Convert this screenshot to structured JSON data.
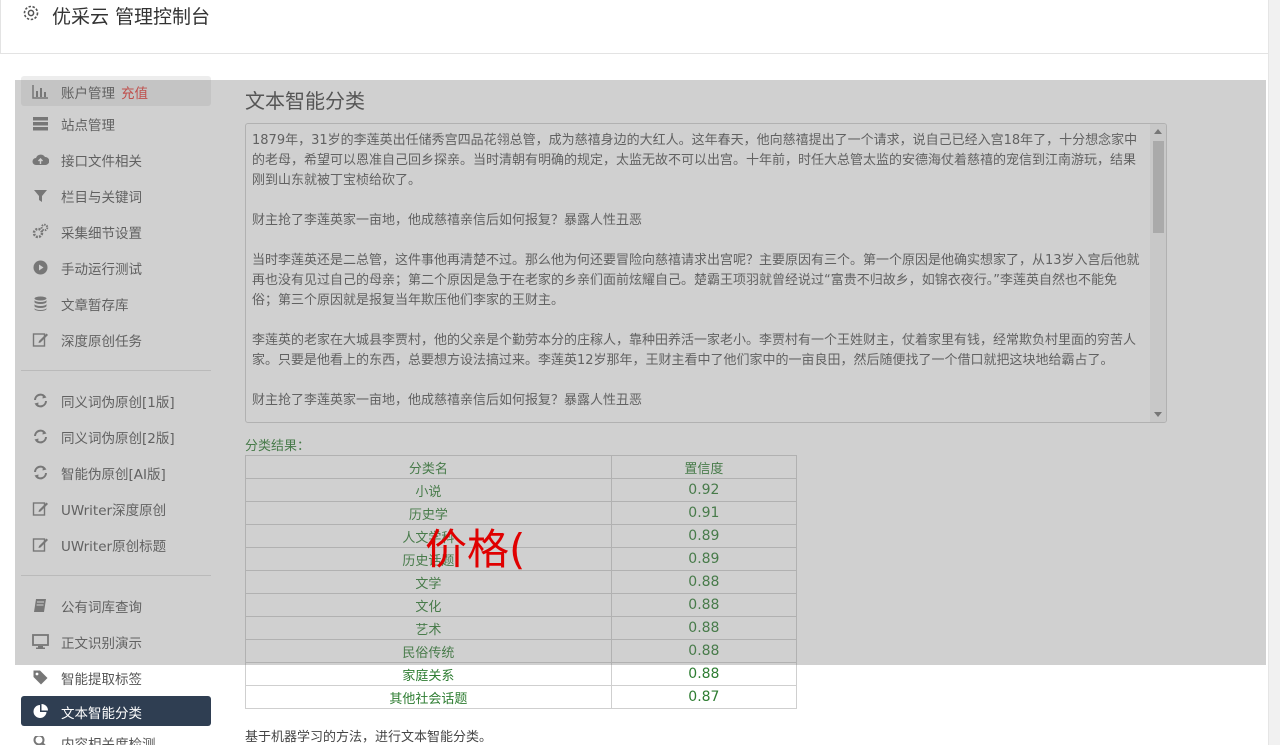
{
  "header": {
    "title": "优采云 管理控制台",
    "icon": "gear-icon"
  },
  "sidebar": {
    "group1": [
      {
        "label": "账户管理",
        "extra": "充值",
        "icon": "bar-chart-icon"
      },
      {
        "label": "站点管理",
        "icon": "server-icon"
      },
      {
        "label": "接口文件相关",
        "icon": "cloud-upload-icon"
      },
      {
        "label": "栏目与关键词",
        "icon": "filter-icon"
      },
      {
        "label": "采集细节设置",
        "icon": "cogs-icon"
      },
      {
        "label": "手动运行测试",
        "icon": "play-circle-icon"
      },
      {
        "label": "文章暂存库",
        "icon": "database-icon"
      },
      {
        "label": "深度原创任务",
        "icon": "edit-icon"
      }
    ],
    "group2": [
      {
        "label": "同义词伪原创[1版]",
        "icon": "refresh-icon"
      },
      {
        "label": "同义词伪原创[2版]",
        "icon": "refresh-icon"
      },
      {
        "label": "智能伪原创[AI版]",
        "icon": "refresh-icon"
      },
      {
        "label": "UWriter深度原创",
        "icon": "edit-icon"
      },
      {
        "label": "UWriter原创标题",
        "icon": "edit-icon"
      }
    ],
    "group3": [
      {
        "label": "公有词库查询",
        "icon": "book-icon"
      },
      {
        "label": "正文识别演示",
        "icon": "monitor-icon"
      },
      {
        "label": "智能提取标签",
        "icon": "tag-icon"
      },
      {
        "label": "文本智能分类",
        "icon": "pie-chart-icon"
      },
      {
        "label": "内容相关度检测",
        "icon": "search-icon"
      }
    ]
  },
  "main": {
    "title": "文本智能分类",
    "text_paragraphs": [
      "1879年，31岁的李莲英出任储秀宫四品花翎总管，成为慈禧身边的大红人。这年春天，他向慈禧提出了一个请求，说自己已经入宫18年了，十分想念家中的老母，希望可以恩准自己回乡探亲。当时清朝有明确的规定，太监无故不可以出宫。十年前，时任大总管太监的安德海仗着慈禧的宠信到江南游玩，结果刚到山东就被丁宝桢给砍了。",
      "财主抢了李莲英家一亩地，他成慈禧亲信后如何报复？暴露人性丑恶",
      "当时李莲英还是二总管，这件事他再清楚不过。那么他为何还要冒险向慈禧请求出宫呢？主要原因有三个。第一个原因是他确实想家了，从13岁入宫后他就再也没有见过自己的母亲；第二个原因是急于在老家的乡亲们面前炫耀自己。楚霸王项羽就曾经说过“富贵不归故乡，如锦衣夜行。”李莲英自然也不能免俗；第三个原因就是报复当年欺压他们李家的王财主。",
      "李莲英的老家在大城县李贾村，他的父亲是个勤劳本分的庄稼人，靠种田养活一家老小。李贾村有一个王姓财主，仗着家里有钱，经常欺负村里面的穷苦人家。只要是他看上的东西，总要想方设法搞过来。李莲英12岁那年，王财主看中了他们家中的一亩良田，然后随便找了一个借口就把这块地给霸占了。",
      "财主抢了李莲英家一亩地，他成慈禧亲信后如何报复？暴露人性丑恶"
    ],
    "result_label": "分类结果：",
    "table": {
      "headers": [
        "分类名",
        "置信度"
      ],
      "rows": [
        [
          "小说",
          "0.92"
        ],
        [
          "历史学",
          "0.91"
        ],
        [
          "人文学科",
          "0.89"
        ],
        [
          "历史话题",
          "0.89"
        ],
        [
          "文学",
          "0.88"
        ],
        [
          "文化",
          "0.88"
        ],
        [
          "艺术",
          "0.88"
        ],
        [
          "民俗传统",
          "0.88"
        ],
        [
          "家庭关系",
          "0.88"
        ],
        [
          "其他社会话题",
          "0.87"
        ]
      ]
    },
    "footer_note": "基于机器学习的方法，进行文本智能分类。"
  },
  "overlay": {
    "text": "价格(",
    "text_color": "#e00000"
  },
  "colors": {
    "active_bg": "#2f3e52",
    "result_green": "#2e7d32",
    "accent_red": "#e53935"
  }
}
